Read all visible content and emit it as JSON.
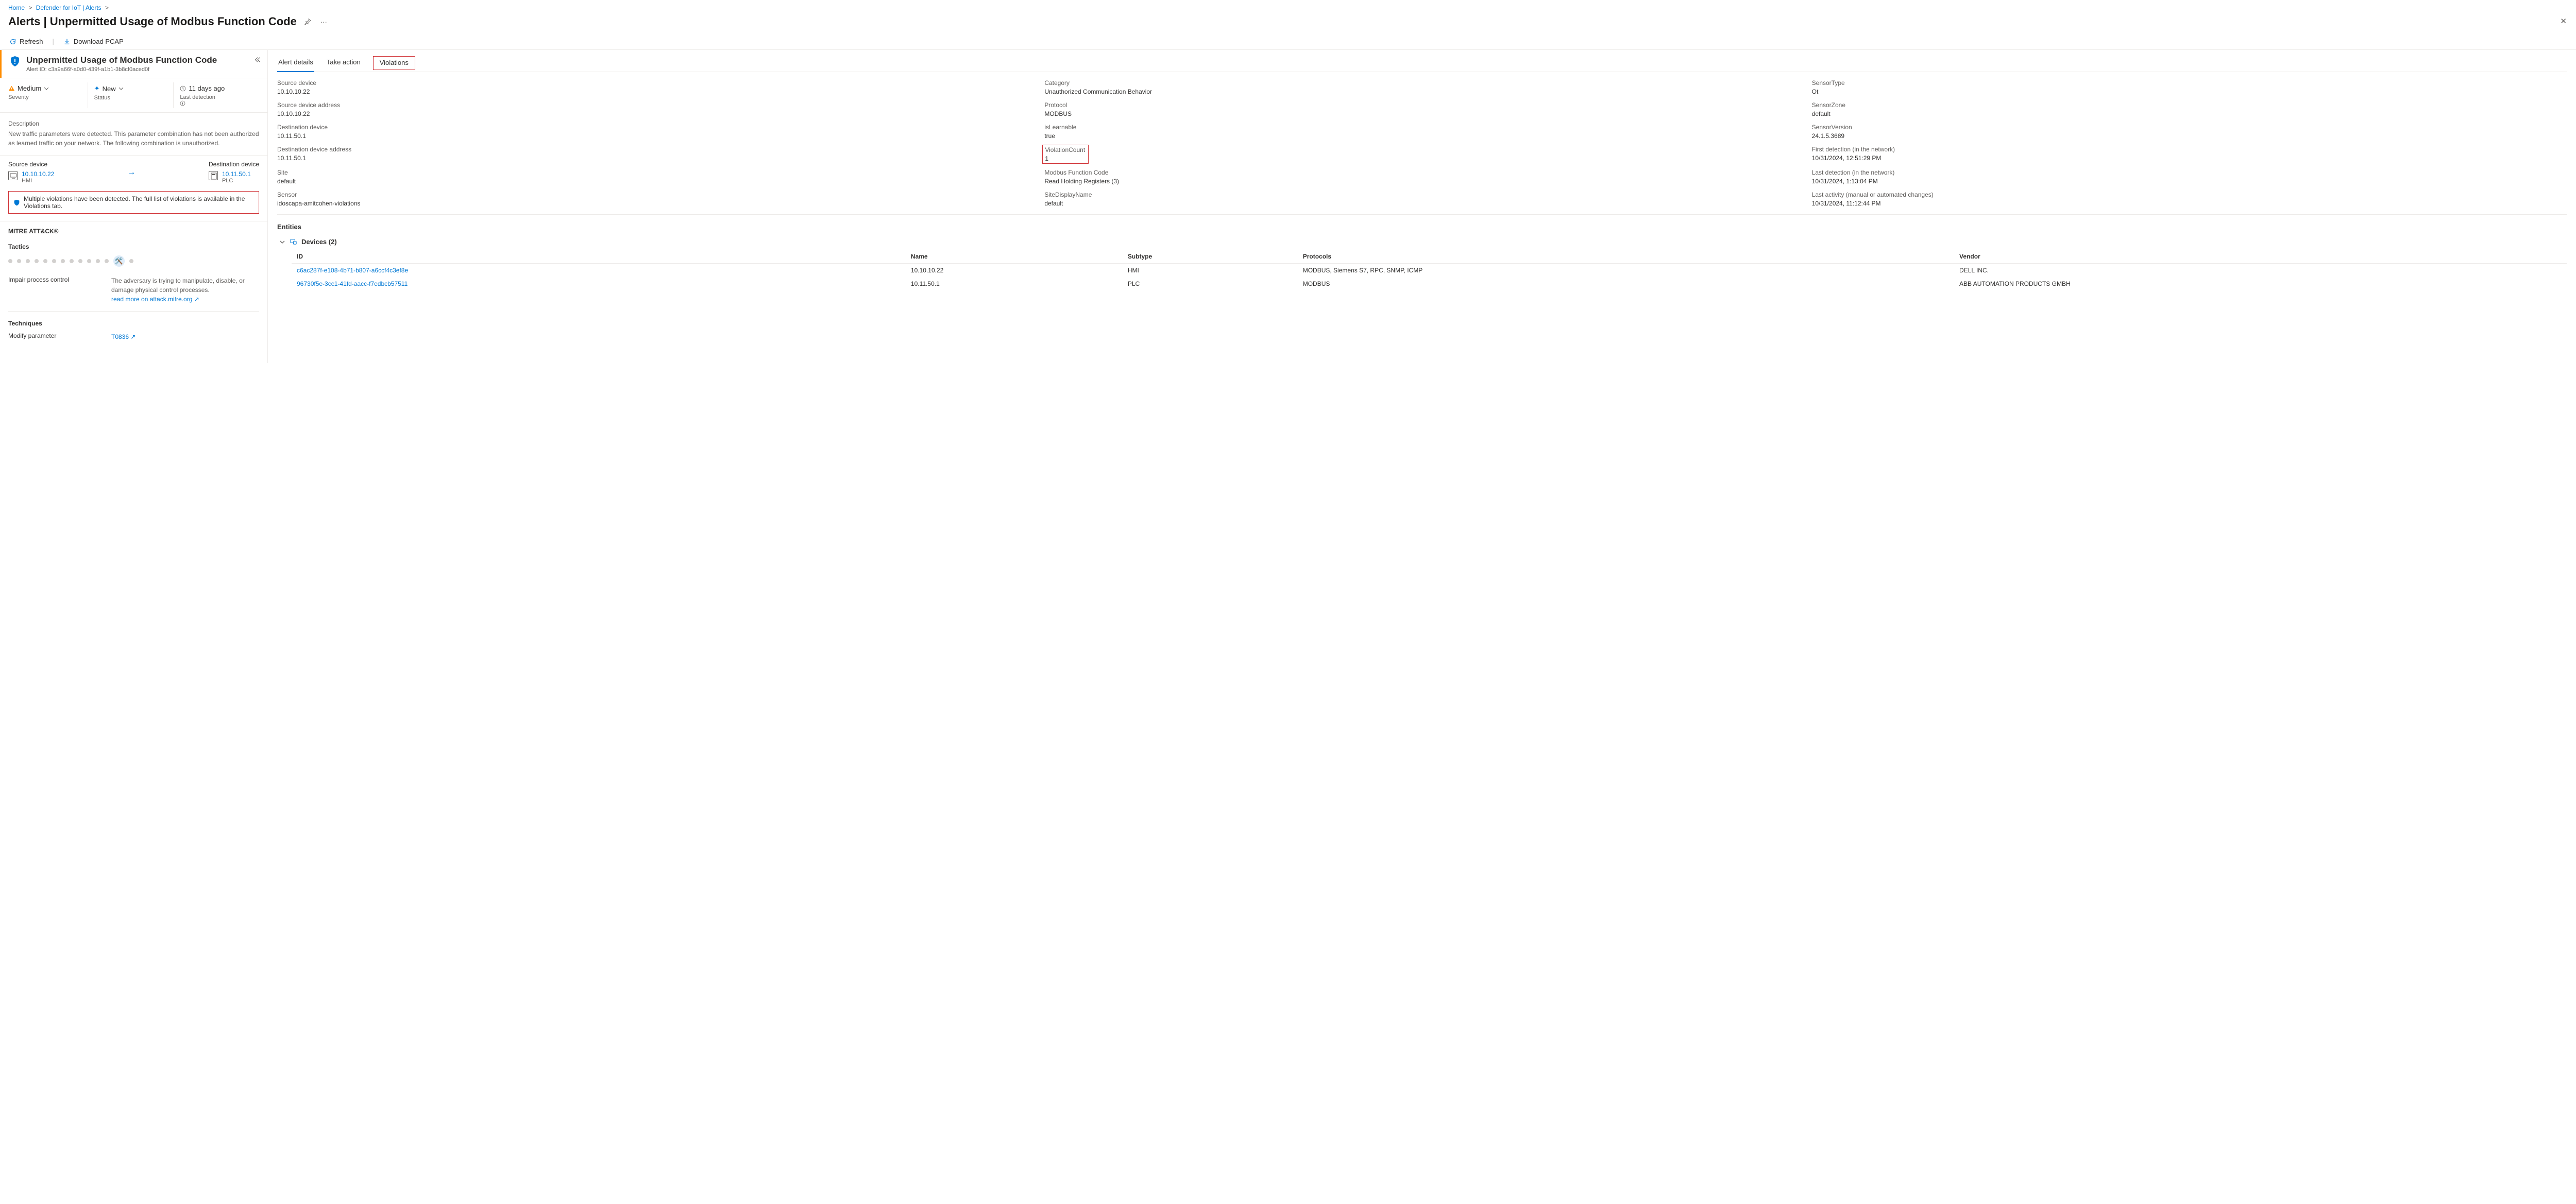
{
  "breadcrumb": {
    "home": "Home",
    "iot": "Defender for IoT | Alerts"
  },
  "title": "Alerts | Unpermitted Usage of Modbus Function Code",
  "toolbar": {
    "refresh": "Refresh",
    "download": "Download PCAP"
  },
  "header": {
    "name": "Unpermitted Usage of Modbus Function Code",
    "alert_id_label": "Alert ID:",
    "alert_id": "c3a9a66f-a0d0-439f-a1b1-3b8cf0aced0f"
  },
  "status": {
    "severity_val": "Medium",
    "severity_lbl": "Severity",
    "status_val": "New",
    "status_lbl": "Status",
    "last_val": "11 days ago",
    "last_lbl": "Last detection"
  },
  "description": {
    "lbl": "Description",
    "txt": "New traffic parameters were detected. This parameter combination has not been authorized as learned traffic on your network. The following combination is unauthorized."
  },
  "endpoints": {
    "src_lbl": "Source device",
    "src_ip": "10.10.10.22",
    "src_type": "HMI",
    "dst_lbl": "Destination device",
    "dst_ip": "10.11.50.1",
    "dst_type": "PLC"
  },
  "notice": "Multiple violations have been detected. The full list of violations is available in the Violations tab.",
  "mitre": {
    "heading": "MITRE ATT&CK®",
    "tactics_lbl": "Tactics",
    "tactic_name": "Impair process control",
    "tactic_desc": "The adversary is trying to manipulate, disable, or damage physical control processes.",
    "tactic_link": "read more on attack.mitre.org",
    "techniques_lbl": "Techniques",
    "technique_name": "Modify parameter",
    "technique_id": "T0836"
  },
  "tabs": {
    "details": "Alert details",
    "action": "Take action",
    "violations": "Violations"
  },
  "details": [
    [
      {
        "k": "Source device",
        "v": "10.10.10.22"
      },
      {
        "k": "Category",
        "v": "Unauthorized Communication Behavior"
      },
      {
        "k": "SensorType",
        "v": "Ot"
      }
    ],
    [
      {
        "k": "Source device address",
        "v": "10.10.10.22"
      },
      {
        "k": "Protocol",
        "v": "MODBUS"
      },
      {
        "k": "SensorZone",
        "v": "default"
      }
    ],
    [
      {
        "k": "Destination device",
        "v": "10.11.50.1"
      },
      {
        "k": "isLearnable",
        "v": "true"
      },
      {
        "k": "SensorVersion",
        "v": "24.1.5.3689"
      }
    ],
    [
      {
        "k": "Destination device address",
        "v": "10.11.50.1"
      },
      {
        "k": "ViolationCount",
        "v": "1",
        "hl": true
      },
      {
        "k": "First detection (in the network)",
        "v": "10/31/2024, 12:51:29 PM"
      }
    ],
    [
      {
        "k": "Site",
        "v": "default"
      },
      {
        "k": "Modbus Function Code",
        "v": "Read Holding Registers (3)"
      },
      {
        "k": "Last detection (in the network)",
        "v": "10/31/2024, 1:13:04 PM"
      }
    ],
    [
      {
        "k": "Sensor",
        "v": "idoscapa-amitcohen-violations"
      },
      {
        "k": "SiteDisplayName",
        "v": "default"
      },
      {
        "k": "Last activity (manual or automated changes)",
        "v": "10/31/2024, 11:12:44 PM"
      }
    ]
  ],
  "entities": {
    "heading": "Entities",
    "group_label": "Devices (2)",
    "cols": {
      "id": "ID",
      "name": "Name",
      "subtype": "Subtype",
      "protocols": "Protocols",
      "vendor": "Vendor"
    },
    "rows": [
      {
        "id": "c6ac287f-e108-4b71-b807-a6ccf4c3ef8e",
        "name": "10.10.10.22",
        "subtype": "HMI",
        "protocols": "MODBUS, Siemens S7, RPC, SNMP, ICMP",
        "vendor": "DELL INC."
      },
      {
        "id": "96730f5e-3cc1-41fd-aacc-f7edbcb57511",
        "name": "10.11.50.1",
        "subtype": "PLC",
        "protocols": "MODBUS",
        "vendor": "ABB AUTOMATION PRODUCTS GMBH"
      }
    ]
  }
}
